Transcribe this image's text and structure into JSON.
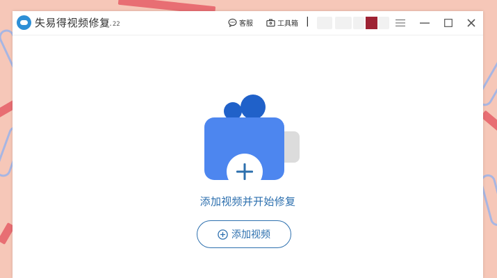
{
  "app": {
    "title": "失易得视频修复",
    "version": "1.22"
  },
  "toolbar": {
    "support_label": "客服",
    "toolbox_label": "工具箱",
    "user_mark": "|"
  },
  "main": {
    "prompt": "添加视频并开始修复",
    "add_button_label": "添加视频"
  },
  "icons": {
    "app_logo": "app-logo-icon",
    "support": "chat-bubble-icon",
    "toolbox": "toolbox-icon",
    "menu": "hamburger-menu-icon",
    "minimize": "minimize-icon",
    "maximize": "maximize-icon",
    "close": "close-icon",
    "camera": "video-camera-icon",
    "add": "plus-circle-icon"
  },
  "colors": {
    "accent": "#2c6fae",
    "camera_body": "#4d86ef",
    "camera_reels": "#2061c9",
    "user_chip": "#9e2233",
    "wallpaper": "#f6c7b8"
  }
}
